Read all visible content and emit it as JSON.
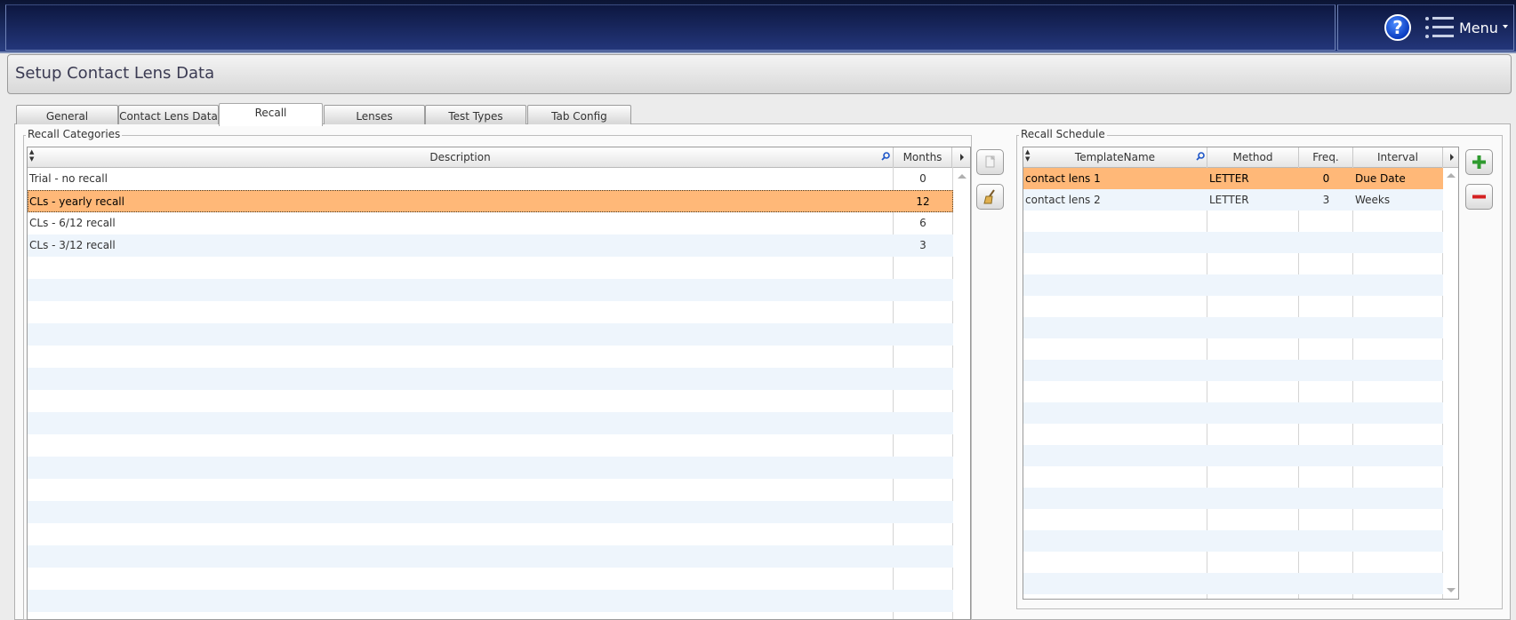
{
  "header": {
    "help_icon": "question-mark-icon",
    "menu_icon": "hamburger-list-icon",
    "menu_label": "Menu"
  },
  "page": {
    "title": "Setup Contact Lens Data"
  },
  "tabs": [
    {
      "label": "General"
    },
    {
      "label": "Contact Lens Data"
    },
    {
      "label": "Recall",
      "active": true
    },
    {
      "label": "Lenses"
    },
    {
      "label": "Test Types"
    },
    {
      "label": "Tab Config"
    }
  ],
  "recall_categories": {
    "group_label": "Recall Categories",
    "columns": {
      "description": "Description",
      "months": "Months"
    },
    "rows": [
      {
        "description": "Trial - no recall",
        "months": "0"
      },
      {
        "description": "CLs - yearly recall",
        "months": "12",
        "selected": true
      },
      {
        "description": "CLs - 6/12 recall",
        "months": "6"
      },
      {
        "description": "CLs - 3/12 recall",
        "months": "3"
      }
    ],
    "buttons": {
      "copy_icon": "copy-document-icon",
      "clear_icon": "broom-clear-icon"
    }
  },
  "recall_schedule": {
    "group_label": "Recall Schedule",
    "columns": {
      "template": "TemplateName",
      "method": "Method",
      "freq": "Freq.",
      "interval": "Interval"
    },
    "rows": [
      {
        "template": "contact lens 1",
        "method": "LETTER",
        "freq": "0",
        "interval": "Due Date",
        "selected": true
      },
      {
        "template": "contact lens 2",
        "method": "LETTER",
        "freq": "3",
        "interval": "Weeks"
      }
    ],
    "buttons": {
      "add_icon": "plus-icon",
      "remove_icon": "minus-icon"
    }
  },
  "colors": {
    "selection": "#ffb878",
    "alt_row": "#eef5fc",
    "header_bg": "#18275a",
    "add_green": "#2f9a2f",
    "remove_red": "#d42020"
  }
}
